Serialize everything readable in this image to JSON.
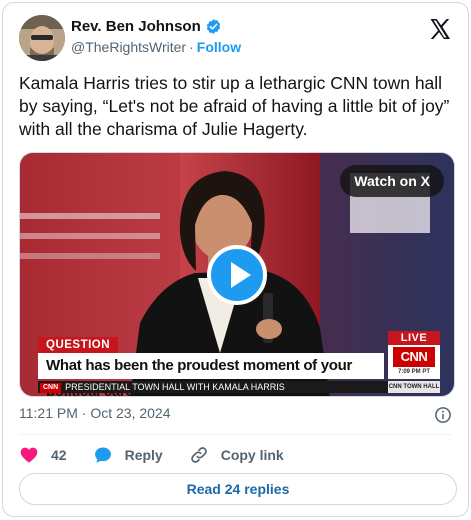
{
  "author": {
    "name": "Rev. Ben Johnson",
    "handle": "@TheRightsWriter",
    "separator": "·",
    "follow_label": "Follow",
    "verified": true
  },
  "platform_logo": "x-logo-icon",
  "tweet": {
    "text": "Kamala Harris tries to stir up a lethargic CNN town hall by saying, “Let's not be afraid of having a little bit of joy” with all the charisma of Julie Hagerty."
  },
  "video": {
    "watch_label": "Watch on X",
    "overlay": {
      "question_tag": "QUESTION",
      "question_text": "What has been the proudest moment of your political career?",
      "live_tag": "LIVE",
      "network_logo": "CNN",
      "time": "7:09 PM PT",
      "ticker_logo": "CNN",
      "ticker_text": "PRESIDENTIAL TOWN HALL WITH KAMALA HARRIS",
      "ticker_right": "CNN TOWN HALL"
    }
  },
  "timestamp": "11:21 PM · Oct 23, 2024",
  "actions": {
    "likes_count": "42",
    "reply_label": "Reply",
    "copy_link_label": "Copy link"
  },
  "read_replies_label": "Read 24 replies",
  "colors": {
    "accent": "#1d9bf0",
    "like": "#f91880",
    "cnn_red": "#cc0000"
  }
}
